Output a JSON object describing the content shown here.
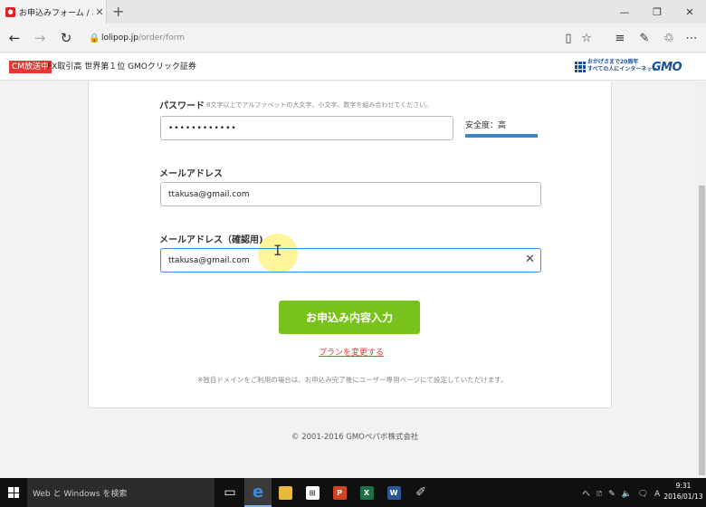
{
  "browser": {
    "tab_title": "お申込みフォーム / お申込",
    "tab_close": "✕",
    "new_tab": "+",
    "window_controls": [
      "—",
      "❐",
      "✕"
    ],
    "url_host": "lolipop.jp",
    "url_path": "/order/form"
  },
  "ad_banner": {
    "badge": "CM放送中",
    "text": "FX取引高 世界第１位 GMOクリック証券",
    "gmo_tagline_1": "おかげさまで20周年",
    "gmo_tagline_2": "すべての人にインターネット",
    "gmo_logo": "GMO"
  },
  "form": {
    "password_label": "パスワード",
    "password_hint": "8文字以上でアルファベットの大文字、小文字、数字を組み合わせてください。",
    "password_value": "••••••••••••",
    "strength_label": "安全度：高",
    "strength_color": "#3a87c8",
    "email_label": "メールアドレス",
    "email_value": "ttakusa@gmail.com",
    "email_confirm_label": "メールアドレス（確認用)",
    "email_confirm_value": "ttakusa@gmail.com",
    "clear_icon": "✕",
    "submit_label": "お申込み内容入力",
    "submit_color": "#79c21d",
    "change_plan_label": "プランを変更する",
    "note": "※独自ドメインをご利用の場合は、お申込み完了後にユーザー専用ページにて設定していただけます。"
  },
  "footer": {
    "copyright": "© 2001-2016 GMOペパボ株式会社"
  },
  "taskbar": {
    "search_placeholder": "Web と Windows を検索",
    "apps": [
      "task-view",
      "edge",
      "file-explorer",
      "store",
      "powerpoint",
      "excel",
      "word",
      "paint"
    ],
    "ppt_letter": "P",
    "excel_letter": "X",
    "word_letter": "W",
    "tray": "へ 🗈 ✎ 🔈 🗨 A",
    "time": "9:31",
    "date": "2016/01/13"
  }
}
